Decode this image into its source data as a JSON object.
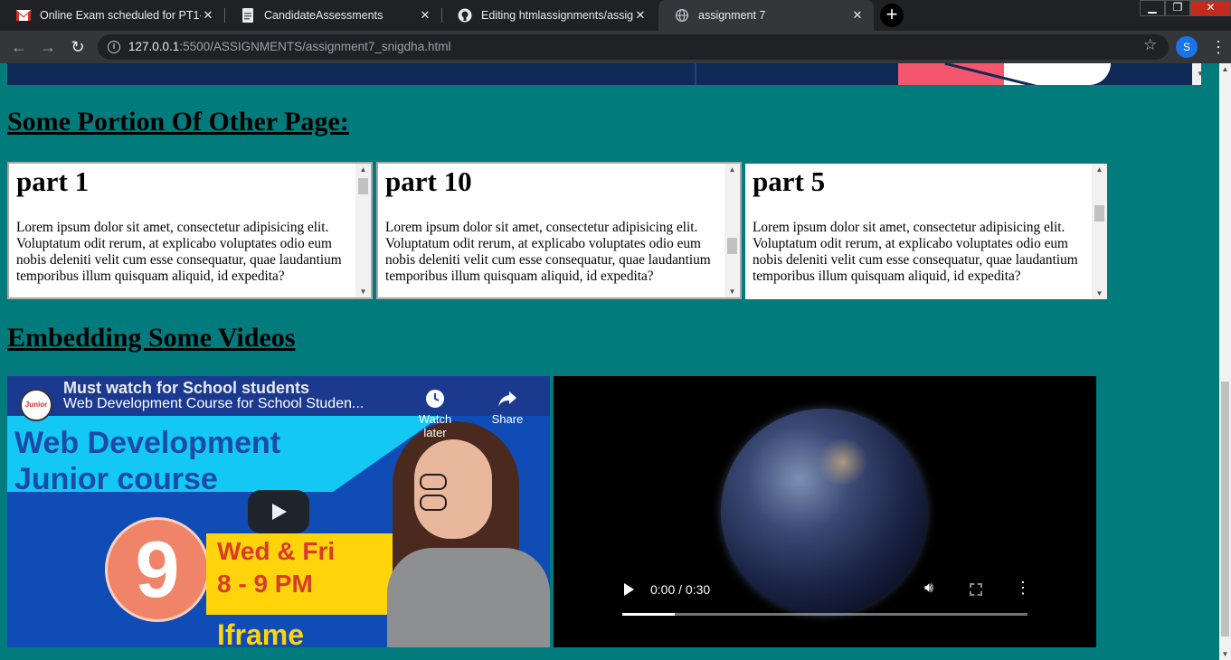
{
  "browser": {
    "tabs": [
      {
        "title": "Online Exam scheduled for PT1-X",
        "icon": "gmail-icon",
        "active": false
      },
      {
        "title": "CandidateAssessments",
        "icon": "doc-icon",
        "active": false
      },
      {
        "title": "Editing htmlassignments/assignm",
        "icon": "github-icon",
        "active": false
      },
      {
        "title": "assignment 7",
        "icon": "globe-icon",
        "active": true
      }
    ],
    "new_tab_label": "+",
    "url_host": "127.0.0.1",
    "url_rest": ":5500/ASSIGNMENTS/assignment7_snigdha.html",
    "profile_initial": "S"
  },
  "page": {
    "section1_title": "Some Portion Of Other Page:",
    "section2_title": "Embedding Some Videos",
    "frames": [
      {
        "heading": "part 1",
        "text": "Lorem ipsum dolor sit amet, consectetur adipisicing elit. Voluptatum odit rerum, at explicabo voluptates odio eum nobis deleniti velit cum esse consequatur, quae laudantium temporibus illum quisquam aliquid, id expedita?"
      },
      {
        "heading": "part 10",
        "text": "Lorem ipsum dolor sit amet, consectetur adipisicing elit. Voluptatum odit rerum, at explicabo voluptates odio eum nobis deleniti velit cum esse consequatur, quae laudantium temporibus illum quisquam aliquid, id expedita?"
      },
      {
        "heading": "part 5",
        "text": "Lorem ipsum dolor sit amet, consectetur adipisicing elit. Voluptatum odit rerum, at explicabo voluptates odio eum nobis deleniti velit cum esse consequatur, quae laudantium temporibus illum quisquam aliquid, id expedita?"
      }
    ],
    "youtube": {
      "banner_top": "Must watch for School students",
      "video_title": "Web Development Course for School Studen...",
      "channel_label": "Junior",
      "watch_later_label": "Watch later",
      "share_label": "Share",
      "thumb_title_line1": "Web Development",
      "thumb_title_line2": "Junior course",
      "thumb_number": "9",
      "thumb_days": "Wed & Fri",
      "thumb_time": "8 - 9 PM",
      "thumb_topic": "Iframe"
    },
    "video": {
      "time_display": "0:00 / 0:30",
      "progress_fraction": 0.13
    }
  },
  "colors": {
    "page_background": "#017b7b",
    "chrome_dark": "#202124",
    "chrome_toolbar": "#35363a"
  }
}
